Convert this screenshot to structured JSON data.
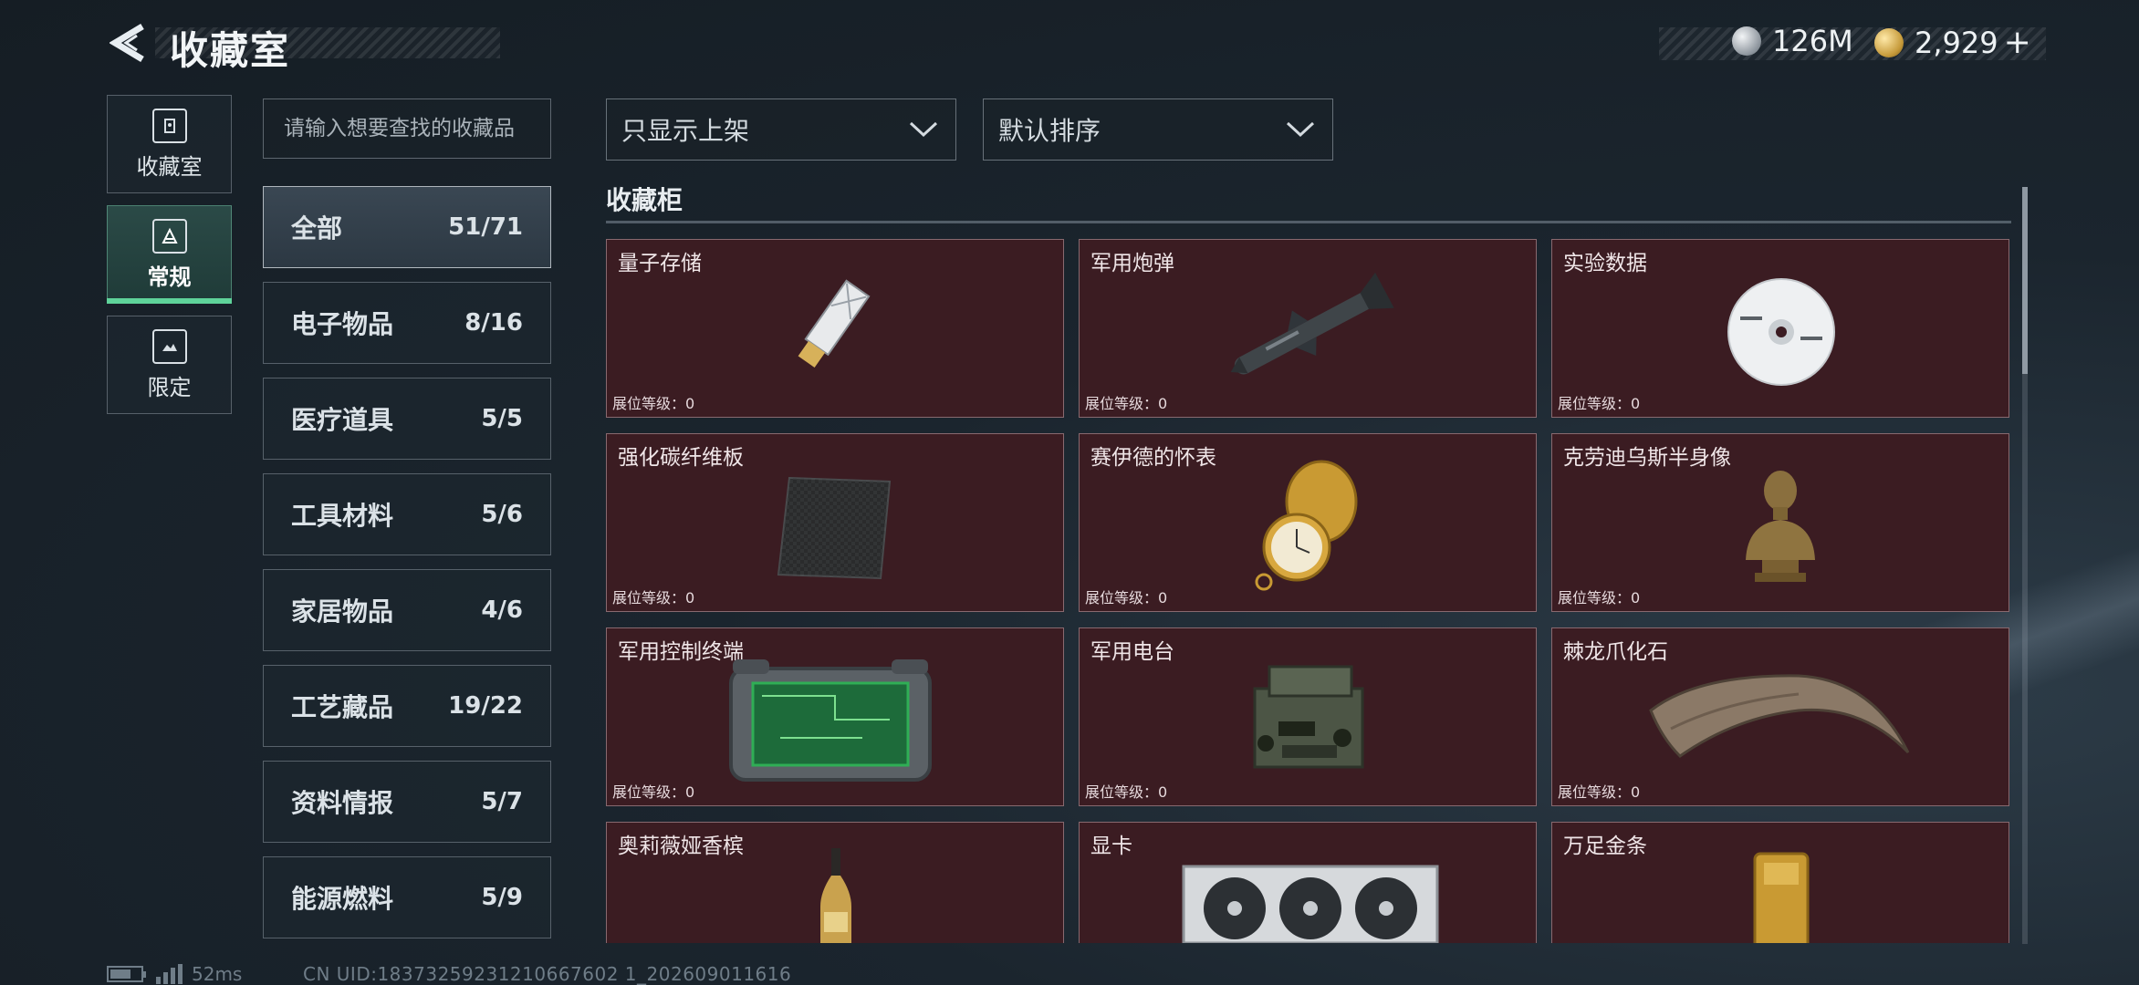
{
  "header": {
    "title": "收藏室",
    "currencies": [
      {
        "icon": "silver-coin-icon",
        "value": "126M"
      },
      {
        "icon": "gold-coin-icon",
        "value": "2,929"
      }
    ],
    "add_label": "+"
  },
  "nav": {
    "items": [
      {
        "label": "收藏室",
        "icon": "collection-room-icon",
        "active": false
      },
      {
        "label": "常规",
        "icon": "regular-icon",
        "active": true
      },
      {
        "label": "限定",
        "icon": "limited-icon",
        "active": false
      }
    ]
  },
  "search": {
    "placeholder": "请输入想要查找的收藏品"
  },
  "filters": {
    "display_filter": "只显示上架",
    "sort": "默认排序"
  },
  "categories": [
    {
      "label": "全部",
      "count": "51/71",
      "active": true
    },
    {
      "label": "电子物品",
      "count": "8/16"
    },
    {
      "label": "医疗道具",
      "count": "5/5"
    },
    {
      "label": "工具材料",
      "count": "5/6"
    },
    {
      "label": "家居物品",
      "count": "4/6"
    },
    {
      "label": "工艺藏品",
      "count": "19/22"
    },
    {
      "label": "资料情报",
      "count": "5/7"
    },
    {
      "label": "能源燃料",
      "count": "5/9"
    }
  ],
  "section": {
    "title": "收藏柜"
  },
  "items": [
    {
      "name": "量子存储",
      "level": "展位等级：0",
      "icon": "usb-drive-icon"
    },
    {
      "name": "军用炮弹",
      "level": "展位等级：0",
      "icon": "missile-icon"
    },
    {
      "name": "实验数据",
      "level": "展位等级：0",
      "icon": "disc-icon"
    },
    {
      "name": "强化碳纤维板",
      "level": "展位等级：0",
      "icon": "carbon-plate-icon"
    },
    {
      "name": "赛伊德的怀表",
      "level": "展位等级：0",
      "icon": "pocket-watch-icon"
    },
    {
      "name": "克劳迪乌斯半身像",
      "level": "展位等级：0",
      "icon": "bust-icon"
    },
    {
      "name": "军用控制终端",
      "level": "展位等级：0",
      "icon": "terminal-icon"
    },
    {
      "name": "军用电台",
      "level": "展位等级：0",
      "icon": "radio-icon"
    },
    {
      "name": "棘龙爪化石",
      "level": "展位等级：0",
      "icon": "claw-fossil-icon"
    },
    {
      "name": "奥莉薇娅香槟",
      "level": "",
      "icon": "champagne-icon"
    },
    {
      "name": "显卡",
      "level": "",
      "icon": "graphics-card-icon"
    },
    {
      "name": "万足金条",
      "level": "",
      "icon": "gold-bar-icon"
    }
  ],
  "footer": {
    "ping": "52ms",
    "uid": "CN UID:18373259231210667602 1_202609011616",
    "battery_level": 0.7
  }
}
